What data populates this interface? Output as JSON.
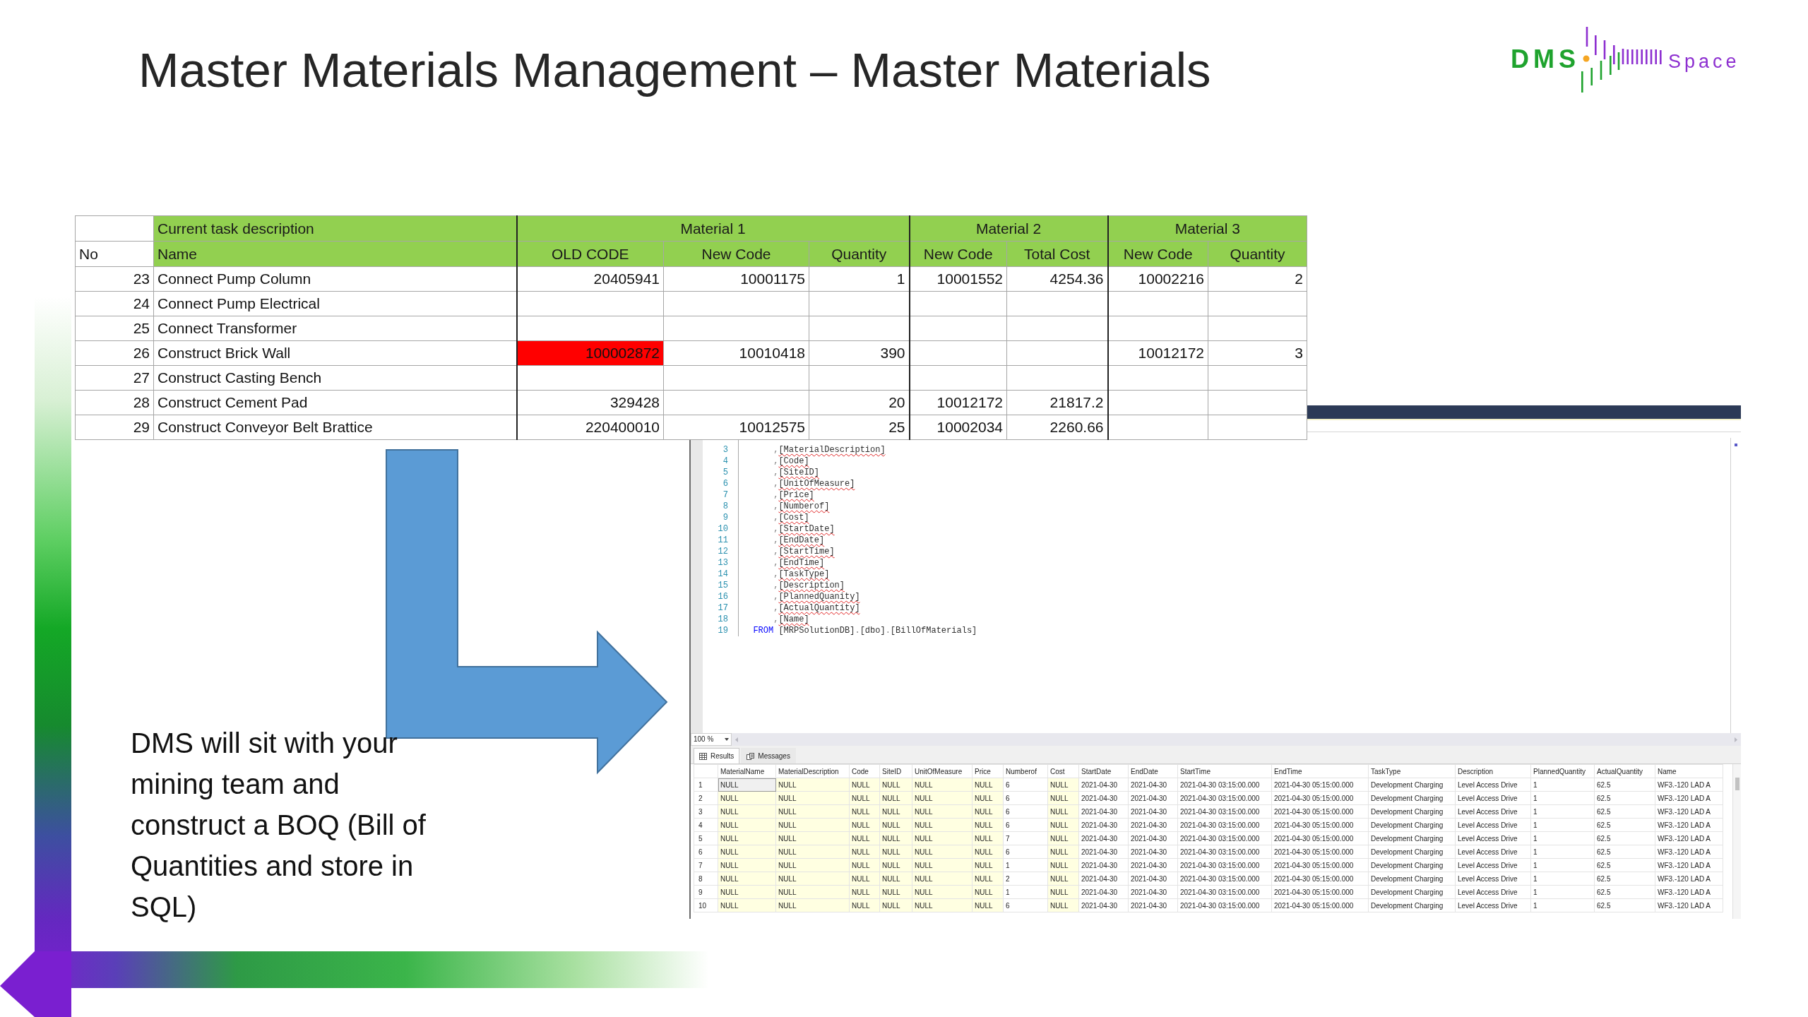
{
  "slide": {
    "title": "Master Materials Management – Master Materials",
    "logo": {
      "primary": "DMS",
      "secondary": "Space"
    },
    "body_text": "DMS will sit with your mining team and construct a BOQ (Bill of Quantities and store in SQL)"
  },
  "bom_sheet": {
    "number_header": "No",
    "groups": [
      {
        "label": "Current task description",
        "columns": [
          "Name"
        ]
      },
      {
        "label": "Material 1",
        "columns": [
          "OLD CODE",
          "New Code",
          "Quantity"
        ]
      },
      {
        "label": "Material 2",
        "columns": [
          "New Code",
          "Total Cost"
        ]
      },
      {
        "label": "Material 3",
        "columns": [
          "New Code",
          "Quantity"
        ]
      }
    ],
    "rows": [
      {
        "no": "23",
        "cells": [
          "Connect Pump Column",
          "20405941",
          "10001175",
          "1",
          "10001552",
          "4254.36",
          "10002216",
          "2"
        ],
        "old_code_flagged": false
      },
      {
        "no": "24",
        "cells": [
          "Connect Pump Electrical",
          null,
          null,
          null,
          null,
          null,
          null,
          null
        ],
        "old_code_flagged": false
      },
      {
        "no": "25",
        "cells": [
          "Connect Transformer",
          null,
          null,
          null,
          null,
          null,
          null,
          null
        ],
        "old_code_flagged": false
      },
      {
        "no": "26",
        "cells": [
          "Construct Brick Wall",
          "100002872",
          "10010418",
          "390",
          null,
          null,
          "10012172",
          "3"
        ],
        "old_code_flagged": true
      },
      {
        "no": "27",
        "cells": [
          "Construct Casting Bench",
          null,
          null,
          null,
          null,
          null,
          null,
          null
        ],
        "old_code_flagged": false
      },
      {
        "no": "28",
        "cells": [
          "Construct Cement Pad",
          "329428",
          null,
          "20",
          "10012172",
          "21817.2",
          null,
          null
        ],
        "old_code_flagged": false
      },
      {
        "no": "29",
        "cells": [
          "Construct Conveyor Belt Brattice",
          "220400010",
          "10012575",
          "25",
          "10002034",
          "2260.66",
          null,
          null
        ],
        "old_code_flagged": false
      }
    ]
  },
  "sql_editor": {
    "lines": [
      {
        "number": "3",
        "kind": "continuation",
        "tokens": [
          {
            "kind": "punct",
            "text": ","
          },
          {
            "kind": "flagged_ident",
            "text": "[MaterialDescription]"
          }
        ]
      },
      {
        "number": "4",
        "kind": "continuation",
        "tokens": [
          {
            "kind": "punct",
            "text": ","
          },
          {
            "kind": "flagged_ident",
            "text": "[Code]"
          }
        ]
      },
      {
        "number": "5",
        "kind": "continuation",
        "tokens": [
          {
            "kind": "punct",
            "text": ","
          },
          {
            "kind": "flagged_ident",
            "text": "[SiteID]"
          }
        ]
      },
      {
        "number": "6",
        "kind": "continuation",
        "tokens": [
          {
            "kind": "punct",
            "text": ","
          },
          {
            "kind": "flagged_ident",
            "text": "[UnitOfMeasure]"
          }
        ]
      },
      {
        "number": "7",
        "kind": "continuation",
        "tokens": [
          {
            "kind": "punct",
            "text": ","
          },
          {
            "kind": "flagged_ident",
            "text": "[Price]"
          }
        ]
      },
      {
        "number": "8",
        "kind": "continuation",
        "tokens": [
          {
            "kind": "punct",
            "text": ","
          },
          {
            "kind": "flagged_ident",
            "text": "[Numberof]"
          }
        ]
      },
      {
        "number": "9",
        "kind": "continuation",
        "tokens": [
          {
            "kind": "punct",
            "text": ","
          },
          {
            "kind": "flagged_ident",
            "text": "[Cost]"
          }
        ]
      },
      {
        "number": "10",
        "kind": "continuation",
        "tokens": [
          {
            "kind": "punct",
            "text": ","
          },
          {
            "kind": "flagged_ident",
            "text": "[StartDate]"
          }
        ]
      },
      {
        "number": "11",
        "kind": "continuation",
        "tokens": [
          {
            "kind": "punct",
            "text": ","
          },
          {
            "kind": "flagged_ident",
            "text": "[EndDate]"
          }
        ]
      },
      {
        "number": "12",
        "kind": "continuation",
        "tokens": [
          {
            "kind": "punct",
            "text": ","
          },
          {
            "kind": "flagged_ident",
            "text": "[StartTime]"
          }
        ]
      },
      {
        "number": "13",
        "kind": "continuation",
        "tokens": [
          {
            "kind": "punct",
            "text": ","
          },
          {
            "kind": "flagged_ident",
            "text": "[EndTime]"
          }
        ]
      },
      {
        "number": "14",
        "kind": "continuation",
        "tokens": [
          {
            "kind": "punct",
            "text": ","
          },
          {
            "kind": "flagged_ident",
            "text": "[TaskType]"
          }
        ]
      },
      {
        "number": "15",
        "kind": "continuation",
        "tokens": [
          {
            "kind": "punct",
            "text": ","
          },
          {
            "kind": "flagged_ident",
            "text": "[Description]"
          }
        ]
      },
      {
        "number": "16",
        "kind": "continuation",
        "tokens": [
          {
            "kind": "punct",
            "text": ","
          },
          {
            "kind": "flagged_ident",
            "text": "[PlannedQuanity]"
          }
        ]
      },
      {
        "number": "17",
        "kind": "continuation",
        "tokens": [
          {
            "kind": "punct",
            "text": ","
          },
          {
            "kind": "flagged_ident",
            "text": "[ActualQuantity]"
          }
        ]
      },
      {
        "number": "18",
        "kind": "continuation",
        "tokens": [
          {
            "kind": "punct",
            "text": ","
          },
          {
            "kind": "flagged_ident",
            "text": "[Name]"
          }
        ]
      },
      {
        "number": "19",
        "kind": "clause",
        "tokens": [
          {
            "kind": "keyword",
            "text": "FROM"
          },
          {
            "kind": "ident",
            "text": "[MRPSolutionDB]"
          },
          {
            "kind": "punct",
            "text": "."
          },
          {
            "kind": "ident",
            "text": "[dbo]"
          },
          {
            "kind": "punct",
            "text": "."
          },
          {
            "kind": "ident",
            "text": "[BillOfMaterials]"
          }
        ]
      }
    ]
  },
  "results": {
    "zoom": "100 %",
    "tabs": [
      {
        "kind": "results",
        "label": "Results",
        "selected": true
      },
      {
        "kind": "messages",
        "label": "Messages",
        "selected": false
      }
    ],
    "columns": [
      {
        "label": "MaterialName",
        "shaded": true
      },
      {
        "label": "MaterialDescription",
        "shaded": true
      },
      {
        "label": "Code",
        "shaded": true
      },
      {
        "label": "SiteID",
        "shaded": true
      },
      {
        "label": "UnitOfMeasure",
        "shaded": true
      },
      {
        "label": "Price",
        "shaded": true
      },
      {
        "label": "Numberof",
        "shaded": false
      },
      {
        "label": "Cost",
        "shaded": true
      },
      {
        "label": "StartDate",
        "shaded": false
      },
      {
        "label": "EndDate",
        "shaded": false
      },
      {
        "label": "StartTime",
        "shaded": false
      },
      {
        "label": "EndTime",
        "shaded": false
      },
      {
        "label": "TaskType",
        "shaded": false
      },
      {
        "label": "Description",
        "shaded": false
      },
      {
        "label": "PlannedQuantity",
        "shaded": false
      },
      {
        "label": "ActualQuantity",
        "shaded": false
      },
      {
        "label": "Name",
        "shaded": false
      }
    ],
    "rows": [
      {
        "number": "1",
        "selected": true,
        "cells": [
          "NULL",
          "NULL",
          "NULL",
          "NULL",
          "NULL",
          "NULL",
          "6",
          "NULL",
          "2021-04-30",
          "2021-04-30",
          "2021-04-30 03:15:00.000",
          "2021-04-30 05:15:00.000",
          "Development Charging",
          "Level Access Drive",
          "1",
          "62.5",
          "WF3.-120 LAD A"
        ]
      },
      {
        "number": "2",
        "selected": false,
        "cells": [
          "NULL",
          "NULL",
          "NULL",
          "NULL",
          "NULL",
          "NULL",
          "6",
          "NULL",
          "2021-04-30",
          "2021-04-30",
          "2021-04-30 03:15:00.000",
          "2021-04-30 05:15:00.000",
          "Development Charging",
          "Level Access Drive",
          "1",
          "62.5",
          "WF3.-120 LAD A"
        ]
      },
      {
        "number": "3",
        "selected": false,
        "cells": [
          "NULL",
          "NULL",
          "NULL",
          "NULL",
          "NULL",
          "NULL",
          "6",
          "NULL",
          "2021-04-30",
          "2021-04-30",
          "2021-04-30 03:15:00.000",
          "2021-04-30 05:15:00.000",
          "Development Charging",
          "Level Access Drive",
          "1",
          "62.5",
          "WF3.-120 LAD A"
        ]
      },
      {
        "number": "4",
        "selected": false,
        "cells": [
          "NULL",
          "NULL",
          "NULL",
          "NULL",
          "NULL",
          "NULL",
          "6",
          "NULL",
          "2021-04-30",
          "2021-04-30",
          "2021-04-30 03:15:00.000",
          "2021-04-30 05:15:00.000",
          "Development Charging",
          "Level Access Drive",
          "1",
          "62.5",
          "WF3.-120 LAD A"
        ]
      },
      {
        "number": "5",
        "selected": false,
        "cells": [
          "NULL",
          "NULL",
          "NULL",
          "NULL",
          "NULL",
          "NULL",
          "7",
          "NULL",
          "2021-04-30",
          "2021-04-30",
          "2021-04-30 03:15:00.000",
          "2021-04-30 05:15:00.000",
          "Development Charging",
          "Level Access Drive",
          "1",
          "62.5",
          "WF3.-120 LAD A"
        ]
      },
      {
        "number": "6",
        "selected": false,
        "cells": [
          "NULL",
          "NULL",
          "NULL",
          "NULL",
          "NULL",
          "NULL",
          "6",
          "NULL",
          "2021-04-30",
          "2021-04-30",
          "2021-04-30 03:15:00.000",
          "2021-04-30 05:15:00.000",
          "Development Charging",
          "Level Access Drive",
          "1",
          "62.5",
          "WF3.-120 LAD A"
        ]
      },
      {
        "number": "7",
        "selected": false,
        "cells": [
          "NULL",
          "NULL",
          "NULL",
          "NULL",
          "NULL",
          "NULL",
          "1",
          "NULL",
          "2021-04-30",
          "2021-04-30",
          "2021-04-30 03:15:00.000",
          "2021-04-30 05:15:00.000",
          "Development Charging",
          "Level Access Drive",
          "1",
          "62.5",
          "WF3.-120 LAD A"
        ]
      },
      {
        "number": "8",
        "selected": false,
        "cells": [
          "NULL",
          "NULL",
          "NULL",
          "NULL",
          "NULL",
          "NULL",
          "2",
          "NULL",
          "2021-04-30",
          "2021-04-30",
          "2021-04-30 03:15:00.000",
          "2021-04-30 05:15:00.000",
          "Development Charging",
          "Level Access Drive",
          "1",
          "62.5",
          "WF3.-120 LAD A"
        ]
      },
      {
        "number": "9",
        "selected": false,
        "cells": [
          "NULL",
          "NULL",
          "NULL",
          "NULL",
          "NULL",
          "NULL",
          "1",
          "NULL",
          "2021-04-30",
          "2021-04-30",
          "2021-04-30 03:15:00.000",
          "2021-04-30 05:15:00.000",
          "Development Charging",
          "Level Access Drive",
          "1",
          "62.5",
          "WF3.-120 LAD A"
        ]
      },
      {
        "number": "10",
        "selected": false,
        "cells": [
          "NULL",
          "NULL",
          "NULL",
          "NULL",
          "NULL",
          "NULL",
          "6",
          "NULL",
          "2021-04-30",
          "2021-04-30",
          "2021-04-30 03:15:00.000",
          "2021-04-30 05:15:00.000",
          "Development Charging",
          "Level Access Drive",
          "1",
          "62.5",
          "WF3.-120 LAD A"
        ]
      }
    ]
  }
}
